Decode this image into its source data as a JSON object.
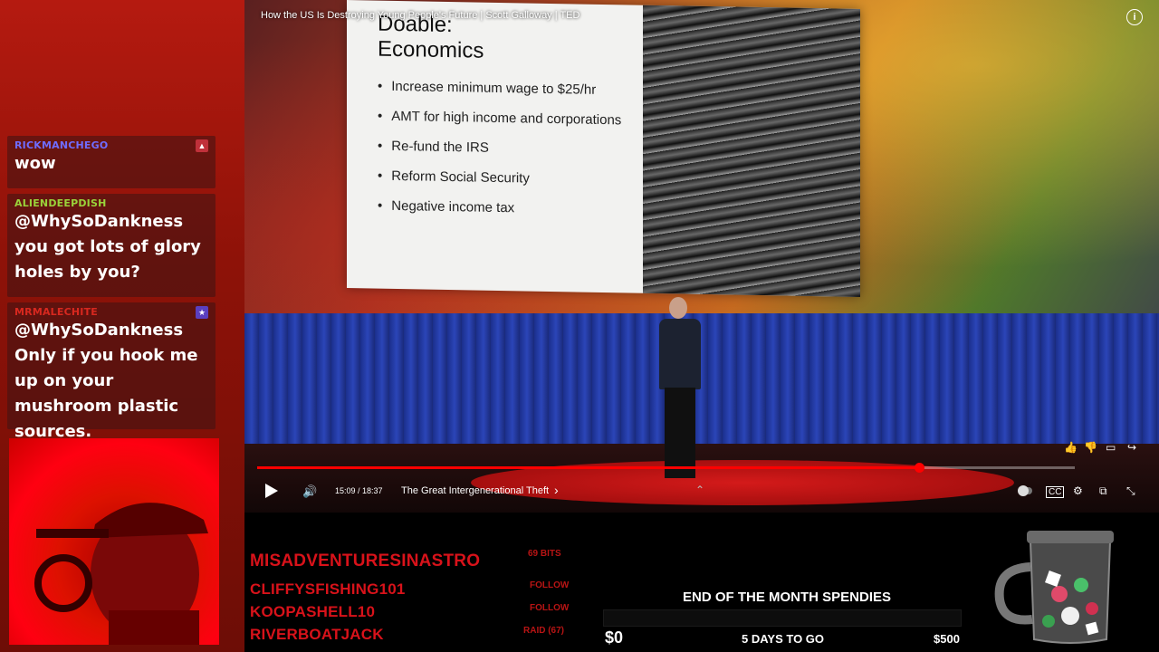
{
  "video": {
    "title": "How the US Is Destroying Young People's Future | Scott Galloway | TED",
    "slide_title_line1": "Doable:",
    "slide_title_line2": "Economics",
    "slide_bullets": [
      "Increase minimum wage to $25/hr",
      "AMT for high income and corporations",
      "Re-fund the IRS",
      "Reform Social Security",
      "Negative income tax"
    ],
    "time": "15:09 / 18:37",
    "chapter": "The Great Intergenerational Theft",
    "progress": 0.81,
    "accent": "#ff0000"
  },
  "chat": [
    {
      "user": "RICKMANCHEGO",
      "color": "#6f6cff",
      "text": "wow",
      "badge_color": "#c0303a"
    },
    {
      "user": "ALIENDEEPDISH",
      "color": "#9ad33a",
      "text": "@WhySoDankness you got lots of glory holes by you?",
      "badge_color": ""
    },
    {
      "user": "MRMALECHITE",
      "color": "#d8281f",
      "text": "@WhySoDankness Only if you hook me up on your mushroom plastic sources.",
      "badge_color": "#5a3fbf"
    }
  ],
  "events": [
    {
      "name": "MISADVENTURESINASTRO",
      "tag": "69 BITS"
    },
    {
      "name": "CLIFFYSFISHING101",
      "tag": "FOLLOW"
    },
    {
      "name": "KOOPASHELL10",
      "tag": "FOLLOW"
    },
    {
      "name": "RIVERBOATJACK",
      "tag": "RAID (67)"
    }
  ],
  "goal": {
    "title": "END OF THE MONTH SPENDIES",
    "start": "$0",
    "days": "5 DAYS TO GO",
    "end": "$500"
  },
  "icons": {
    "info": "info-icon",
    "play": "play-icon",
    "volume": "volume-icon",
    "like": "thumbs-up-icon",
    "dislike": "thumbs-down-icon",
    "comment": "comment-icon",
    "share": "share-icon",
    "captions": "captions-icon",
    "settings": "gear-icon",
    "cast": "cast-icon",
    "minimize": "minimize-icon"
  }
}
